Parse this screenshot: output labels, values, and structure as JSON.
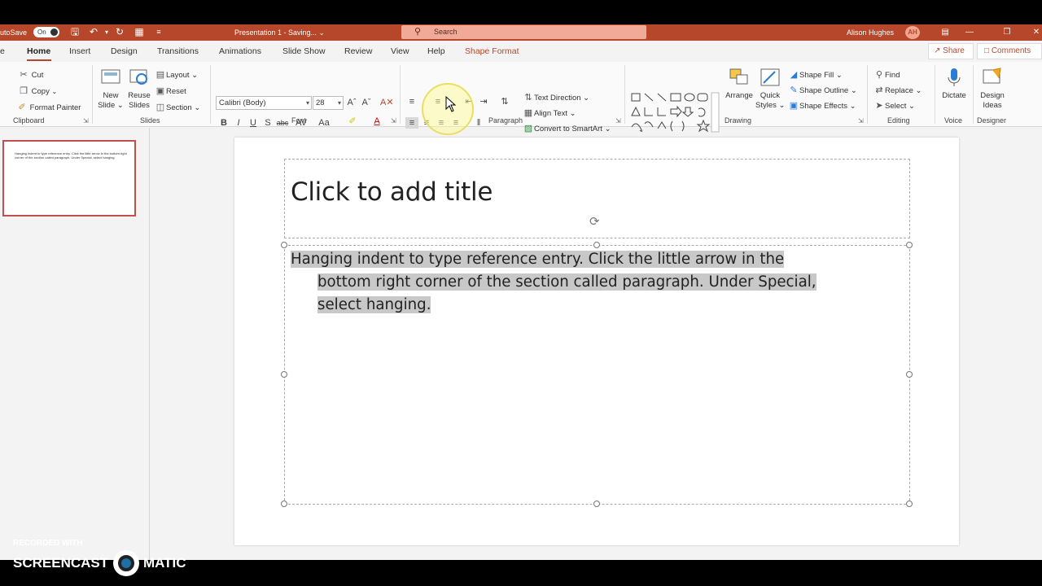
{
  "colors": {
    "accent": "#b7472a",
    "highlight": "#c8c8c8"
  },
  "titlebar": {
    "autosave_label": "utoSave",
    "autosave_state": "On",
    "doc_title": "Presentation 1  -  Saving...  ⌄",
    "search_placeholder": "Search",
    "user_name": "Alison Hughes",
    "user_initials": "AH"
  },
  "tabs": {
    "items": [
      "e",
      "Home",
      "Insert",
      "Design",
      "Transitions",
      "Animations",
      "Slide Show",
      "Review",
      "View",
      "Help"
    ],
    "contextual": "Shape Format",
    "share": "Share",
    "comments": "Comments"
  },
  "ribbon": {
    "clipboard": {
      "label": "Clipboard",
      "cut": "Cut",
      "copy": "Copy",
      "format_painter": "Format Painter"
    },
    "slides": {
      "label": "Slides",
      "new_slide_1": "New",
      "new_slide_2": "Slide ⌄",
      "reuse_1": "Reuse",
      "reuse_2": "Slides",
      "layout": "Layout ⌄",
      "reset": "Reset",
      "section": "Section ⌄"
    },
    "font": {
      "label": "Font",
      "family": "Calibri (Body)",
      "size": "28",
      "bold": "B",
      "italic": "I",
      "underline": "U",
      "shadow": "S",
      "strike": "abc",
      "spacing": "AV",
      "case": "Aa"
    },
    "paragraph": {
      "label": "Paragraph",
      "text_direction": "Text Direction ⌄",
      "align_text": "Align Text ⌄",
      "smartart": "Convert to SmartArt ⌄"
    },
    "drawing": {
      "label": "Drawing",
      "arrange": "Arrange",
      "quick_styles_1": "Quick",
      "quick_styles_2": "Styles ⌄",
      "shape_fill": "Shape Fill ⌄",
      "shape_outline": "Shape Outline ⌄",
      "shape_effects": "Shape Effects ⌄"
    },
    "editing": {
      "label": "Editing",
      "find": "Find",
      "replace": "Replace ⌄",
      "select": "Select ⌄"
    },
    "voice": {
      "label": "Voice",
      "dictate": "Dictate"
    },
    "designer": {
      "label": "Designer",
      "design_ideas_1": "Design",
      "design_ideas_2": "Ideas"
    }
  },
  "thumbnail": {
    "text": "Hanging indent to type reference entry.  Click the little arrow in the bottom right corner of the section called paragraph.  Under Special, select hanging."
  },
  "slide": {
    "title_placeholder": "Click to add title",
    "body_line1": "Hanging indent to type reference entry.  Click the little arrow in the",
    "body_line2": "bottom right corner of the section called paragraph.  Under Special,",
    "body_line3": "select hanging."
  },
  "watermark": {
    "line1": "RECORDED WITH",
    "line2a": "SCREENCAST",
    "line2b": "MATIC"
  }
}
